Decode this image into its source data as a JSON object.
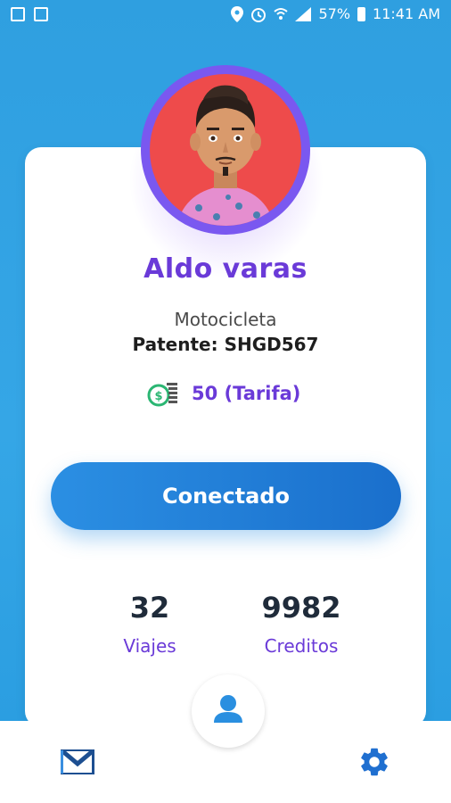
{
  "status_bar": {
    "battery": "57%",
    "time": "11:41 AM"
  },
  "profile": {
    "name": "Aldo varas",
    "vehicle_type": "Motocicleta",
    "plate_label": "Patente: SHGD567",
    "fare": "50 (Tarifa)"
  },
  "connect_button": {
    "label": "Conectado"
  },
  "stats": {
    "trips": {
      "value": "32",
      "label": "Viajes"
    },
    "credits": {
      "value": "9982",
      "label": "Creditos"
    }
  },
  "colors": {
    "background_blue": "#35a6e6",
    "accent_purple": "#6a3ad8",
    "button_blue": "#2b8fe3",
    "avatar_red": "#ee4b4b"
  }
}
